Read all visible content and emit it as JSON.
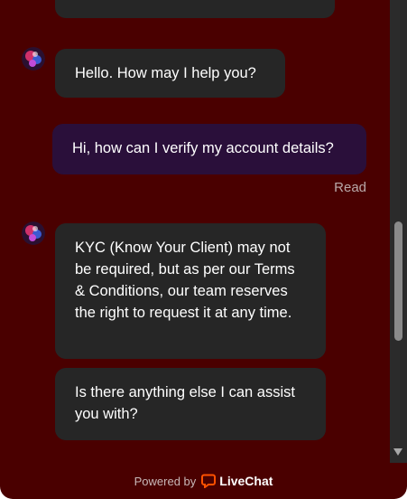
{
  "conversation": {
    "messages": [
      {
        "author": "agent",
        "text": "Hello. How may I help you?"
      },
      {
        "author": "visitor",
        "text": "Hi, how can I verify my account details?"
      },
      {
        "author": "agent",
        "text": "KYC (Know Your Client) may not be required, but as per our Terms & Conditions, our team reserves the right to request it at any time."
      },
      {
        "author": "agent",
        "text": "Is there anything else I can assist you with?"
      }
    ],
    "read_status": "Read"
  },
  "footer": {
    "powered_by": "Powered by",
    "brand": "LiveChat",
    "brand_icon": "livechat-logo-icon"
  },
  "colors": {
    "background": "#4a0000",
    "agent_bubble": "#262626",
    "visitor_bubble": "#2a0f3a",
    "brand_accent": "#ff5100"
  }
}
